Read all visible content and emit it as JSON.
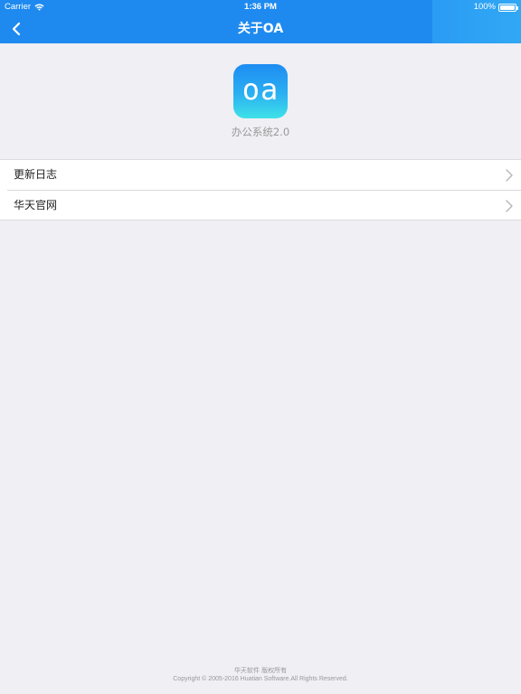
{
  "status_bar": {
    "carrier": "Carrier",
    "time": "1:36 PM",
    "battery": "100%"
  },
  "nav": {
    "title": "关于OA",
    "back_icon": "chevron-left-icon"
  },
  "app": {
    "icon_text": "oa",
    "name": "办公系统2.0"
  },
  "menu": {
    "items": [
      {
        "label": "更新日志",
        "icon": "chevron-right-icon"
      },
      {
        "label": "华天官网",
        "icon": "chevron-right-icon"
      }
    ]
  },
  "footer": {
    "line1": "华天软件 版权所有",
    "line2": "Copyright © 2005-2016 Huatian Software.All Rights Reserved."
  },
  "colors": {
    "header": "#1e8af0",
    "background": "#efeff4"
  }
}
